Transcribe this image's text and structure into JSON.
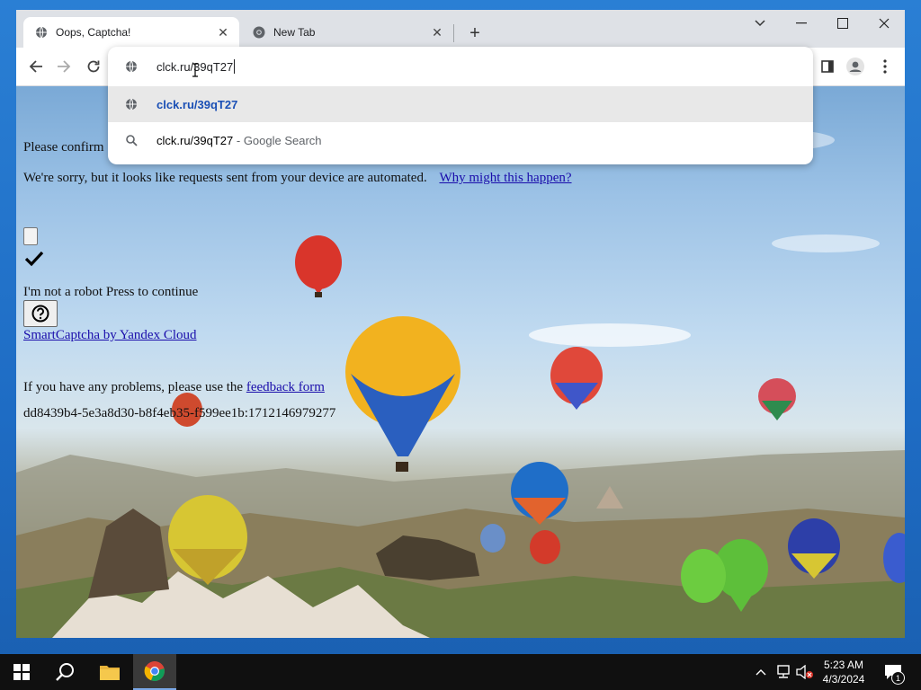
{
  "browser": {
    "tabs": [
      {
        "title": "Oops, Captcha!",
        "active": true
      },
      {
        "title": "New Tab",
        "active": false
      }
    ],
    "omnibox": {
      "value": "clck.ru/39qT27",
      "suggestions": [
        {
          "text": "clck.ru/39qT27",
          "suffix": ""
        },
        {
          "text": "clck.ru/39qT27",
          "suffix": " - Google Search"
        }
      ]
    }
  },
  "page": {
    "line1": "Please confirm",
    "line2": "We're sorry, but it looks like requests sent from your device are automated.",
    "why_link": "Why might this happen?",
    "robot_text": "I'm not a robot Press to continue",
    "smartcaptcha_link": "SmartCaptcha by Yandex Cloud",
    "problems_text": "If you have any problems, please use the",
    "feedback_link": "feedback form",
    "request_id": "dd8439b4-5e3a8d30-b8f4eb35-f599ee1b:1712146979277"
  },
  "taskbar": {
    "time": "5:23 AM",
    "date": "4/3/2024",
    "notification_count": "1"
  },
  "colors": {
    "link": "#1a0dab",
    "suggestion_link": "#1a4fb5",
    "tab_strip": "#dee1e6",
    "taskbar": "#101010"
  }
}
